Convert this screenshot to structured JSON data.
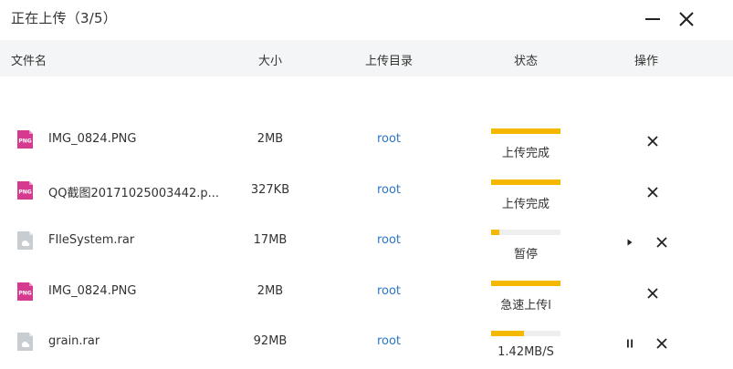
{
  "window": {
    "title": "正在上传（3/5）",
    "minimize_icon": "minimize-icon",
    "close_icon": "close-icon"
  },
  "columns": {
    "name": "文件名",
    "size": "大小",
    "directory": "上传目录",
    "status": "状态",
    "actions": "操作"
  },
  "colors": {
    "progress": "#f5b800",
    "track": "#eeeeee",
    "link": "#2b77c6",
    "png_icon": "#d63a8f",
    "archive_icon": "#c8cdd2"
  },
  "files": [
    {
      "name": "IMG_0824.PNG",
      "icon": "png-file-icon",
      "icon_label": "PNG",
      "size": "2MB",
      "directory": "root",
      "progress": 1.0,
      "status": "上传完成",
      "actions": [
        "close"
      ]
    },
    {
      "name": "QQ截图20171025003442.p...",
      "icon": "png-file-icon",
      "icon_label": "PNG",
      "size": "327KB",
      "directory": "root",
      "progress": 1.0,
      "status": "上传完成",
      "actions": [
        "close"
      ]
    },
    {
      "name": "FIleSystem.rar",
      "icon": "archive-file-icon",
      "icon_label": "",
      "size": "17MB",
      "directory": "root",
      "progress": 0.12,
      "status": "暂停",
      "actions": [
        "play",
        "close"
      ]
    },
    {
      "name": "IMG_0824.PNG",
      "icon": "png-file-icon",
      "icon_label": "PNG",
      "size": "2MB",
      "directory": "root",
      "progress": 1.0,
      "status": "急速上传l",
      "actions": [
        "close"
      ]
    },
    {
      "name": "grain.rar",
      "icon": "archive-file-icon",
      "icon_label": "",
      "size": "92MB",
      "directory": "root",
      "progress": 0.48,
      "status": "1.42MB/S",
      "actions": [
        "pause",
        "close"
      ]
    }
  ]
}
